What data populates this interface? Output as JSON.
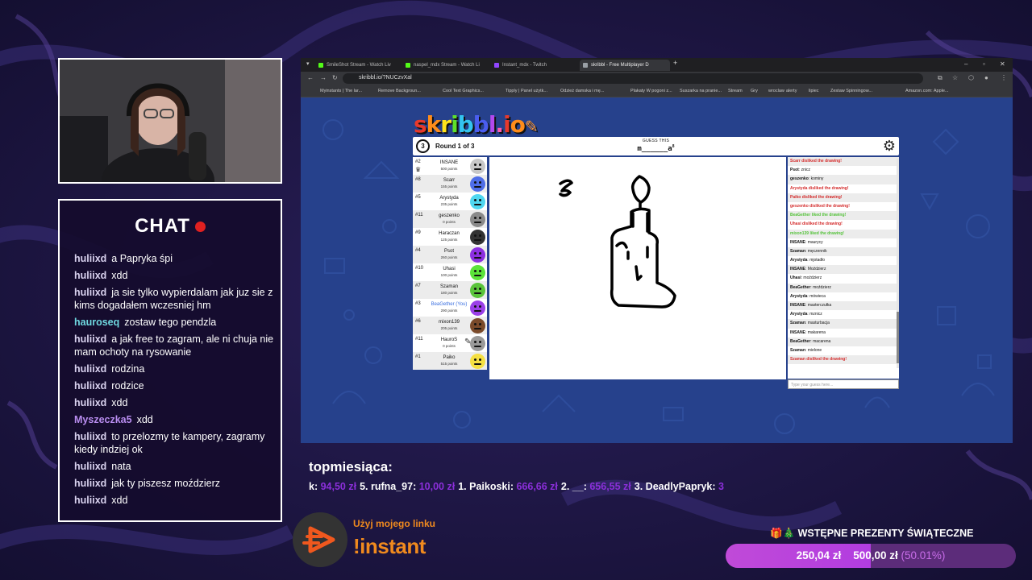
{
  "chat": {
    "title": "CHAT",
    "messages": [
      {
        "user": "huliixd",
        "color": "#d9d2ef",
        "text": "a Papryka śpi"
      },
      {
        "user": "huliixd",
        "color": "#d9d2ef",
        "text": "xdd"
      },
      {
        "user": "huliixd",
        "color": "#d9d2ef",
        "text": "ja sie tylko wypierdalam jak juz sie z kims dogadałem wczesniej hm"
      },
      {
        "user": "hauroseq",
        "color": "#6fd8e0",
        "text": "zostaw tego pendzla"
      },
      {
        "user": "huliixd",
        "color": "#d9d2ef",
        "text": "a jak free to zagram, ale ni chuja nie mam ochoty na rysowanie"
      },
      {
        "user": "huliixd",
        "color": "#d9d2ef",
        "text": "rodzina"
      },
      {
        "user": "huliixd",
        "color": "#d9d2ef",
        "text": "rodzice"
      },
      {
        "user": "huliixd",
        "color": "#d9d2ef",
        "text": "xdd"
      },
      {
        "user": "Myszeczka5",
        "color": "#b98df0",
        "text": "xdd"
      },
      {
        "user": "huliixd",
        "color": "#d9d2ef",
        "text": "to przelozmy te kampery, zagramy kiedy indziej ok"
      },
      {
        "user": "huliixd",
        "color": "#d9d2ef",
        "text": "nata"
      },
      {
        "user": "huliixd",
        "color": "#d9d2ef",
        "text": "jak ty piszesz moździerz"
      },
      {
        "user": "huliixd",
        "color": "#d9d2ef",
        "text": "xdd"
      }
    ]
  },
  "browser": {
    "tabs": [
      {
        "label": "SmileShot Stream - Watch Liv",
        "color": "#53fc18"
      },
      {
        "label": "naspel_mdx Stream - Watch Li",
        "color": "#53fc18"
      },
      {
        "label": "Instant_mdx - Twitch",
        "color": "#9146ff"
      },
      {
        "label": "skribbl - Free Multiplayer D",
        "color": "#9aa0a6"
      }
    ],
    "url": "skribbl.io/?NUCzvXal",
    "bookmarks": [
      "Myinstants | The lar...",
      "Remove Backgroun...",
      "Cool Text Graphics...",
      "Tipply | Panel użytk...",
      "Odzież damska i mę...",
      "Plakaty W pogoni z...",
      "Suszarka na pranie...",
      "Stream",
      "Gry",
      "wroclaw",
      "alerty",
      "lipiec",
      "Zestaw Spinningow...",
      "Amazon.com: Apple..."
    ]
  },
  "game": {
    "logo": "skribbl.io",
    "logo_colors": [
      "#e8392b",
      "#ff8c1a",
      "#ffe31a",
      "#5ee02b",
      "#33c4f0",
      "#4b5df0",
      "#b449ee",
      "#ff5cb1",
      "#e8392b",
      "#ff8c1a"
    ],
    "round_number": "3",
    "round_text": "Round 1 of 3",
    "guess_label": "GUESS THIS",
    "guess_word": "m______a",
    "guess_hint_sup": "8",
    "players": [
      {
        "rank": "#2",
        "name": "INSANE",
        "points": "500 points",
        "color": "#c8c8c8",
        "crown": true
      },
      {
        "rank": "#8",
        "name": "Scarr",
        "points": "155 points",
        "color": "#4f6ee8"
      },
      {
        "rank": "#5",
        "name": "Arystyda",
        "points": "235 points",
        "color": "#4fd7f0"
      },
      {
        "rank": "#11",
        "name": "geszenko",
        "points": "0 points",
        "color": "#8a8a8a"
      },
      {
        "rank": "#9",
        "name": "Haraczan",
        "points": "125 points",
        "color": "#333333"
      },
      {
        "rank": "#4",
        "name": "Psot",
        "points": "260 points",
        "color": "#8c2fe0"
      },
      {
        "rank": "#10",
        "name": "Uhasi",
        "points": "100 points",
        "color": "#5be33a"
      },
      {
        "rank": "#7",
        "name": "Szaman",
        "points": "180 points",
        "color": "#5ac43a"
      },
      {
        "rank": "#3",
        "name": "BeaGether (You)",
        "points": "290 points",
        "color": "#9b3fe8",
        "you": true
      },
      {
        "rank": "#6",
        "name": "mixon139",
        "points": "205 points",
        "color": "#7a4a2a"
      },
      {
        "rank": "#11",
        "name": "HauroS",
        "points": "0 points",
        "color": "#9a9a9a",
        "drawing": true
      },
      {
        "rank": "#1",
        "name": "Paiko",
        "points": "515 points",
        "color": "#f5e043"
      }
    ],
    "chat": [
      {
        "type": "red",
        "text": "Scarr disliked the drawing!"
      },
      {
        "user": "Psot",
        "text": "znicz"
      },
      {
        "user": "geszenko",
        "text": "kominy"
      },
      {
        "type": "red",
        "text": "Arystyda disliked the drawing!"
      },
      {
        "type": "red",
        "text": "Paiko disliked the drawing!"
      },
      {
        "type": "red",
        "text": "geszenko disliked the drawing!"
      },
      {
        "type": "green",
        "text": "BeaGether liked the drawing!"
      },
      {
        "type": "red",
        "text": "Uhasi disliked the drawing!"
      },
      {
        "type": "green",
        "text": "mixon139 liked the drawing!"
      },
      {
        "user": "INSANE",
        "text": "maurycy"
      },
      {
        "user": "Szaman",
        "text": "męczennik"
      },
      {
        "user": "Arystyda",
        "text": "mjotadło"
      },
      {
        "user": "INSANE",
        "text": "Moździerz"
      },
      {
        "user": "Uhasi",
        "text": "moździerz"
      },
      {
        "user": "BeaGether",
        "text": "moździerz"
      },
      {
        "user": "Arystyda",
        "text": "mówieca"
      },
      {
        "user": "INSANE",
        "text": "masterczułka"
      },
      {
        "user": "Arystyda",
        "text": "mznicz"
      },
      {
        "user": "Szaman",
        "text": "masturbacja"
      },
      {
        "user": "INSANE",
        "text": "makarena"
      },
      {
        "user": "BeaGether",
        "text": "macarena"
      },
      {
        "user": "Szaman",
        "text": "mielone"
      },
      {
        "type": "red",
        "text": "Szaman disliked the drawing!"
      }
    ],
    "guess_placeholder": "Type your guess here..."
  },
  "overlay": {
    "top_title": "topmiesiąca:",
    "ticker": [
      {
        "name": "k:",
        "amount": "94,50 zł"
      },
      {
        "name": "5. rufna_97:",
        "amount": "10,00 zł"
      },
      {
        "name": "1. Paikoski:",
        "amount": "666,66 zł"
      },
      {
        "name": "2. __:",
        "amount": "656,55 zł"
      },
      {
        "name": "3. DeadlyPapryk:",
        "amount": "3"
      }
    ],
    "instant_line1": "Użyj mojego linku",
    "instant_cmd": "!instant",
    "gift_title": "🎁🎄 WSTĘPNE PREZENTY ŚWIĄTECZNE",
    "goal_current": "250,04 zł",
    "goal_target": "500,00 zł",
    "goal_percent_text": "(50.01%)",
    "goal_fraction": 0.5001
  }
}
